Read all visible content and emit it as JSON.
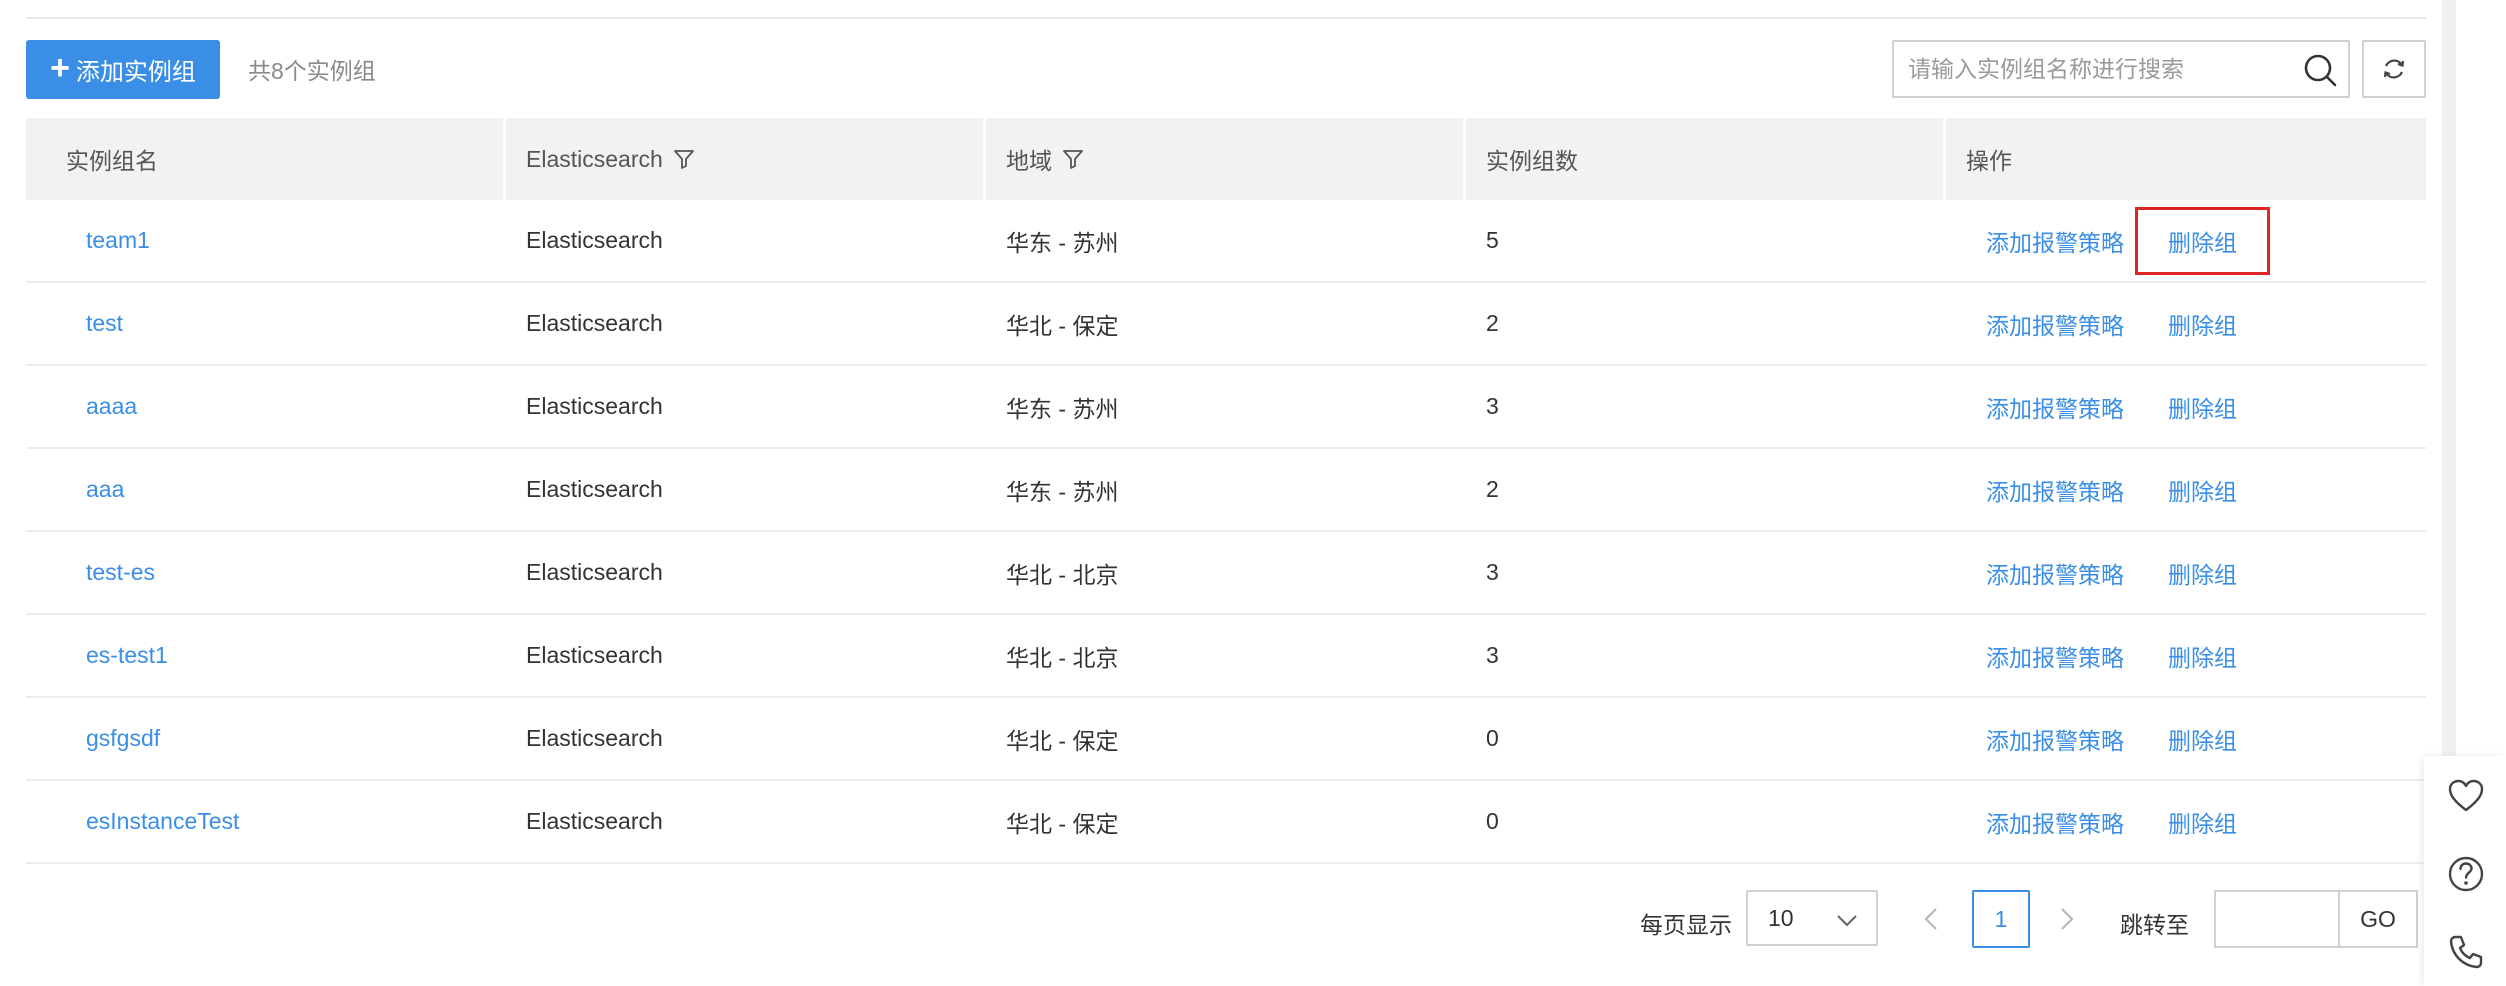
{
  "toolbar": {
    "add_label": "添加实例组",
    "total_text": "共8个实例组",
    "search_placeholder": "请输入实例组名称进行搜索"
  },
  "table": {
    "columns": [
      "实例组名",
      "Elasticsearch",
      "地域",
      "实例组数",
      "操作"
    ],
    "filterable": [
      false,
      true,
      true,
      false,
      false
    ],
    "action_labels": {
      "add_policy": "添加报警策略",
      "delete_group": "删除组"
    },
    "rows": [
      {
        "name": "team1",
        "product": "Elasticsearch",
        "region": "华东 - 苏州",
        "count": "5"
      },
      {
        "name": "test",
        "product": "Elasticsearch",
        "region": "华北 - 保定",
        "count": "2"
      },
      {
        "name": "aaaa",
        "product": "Elasticsearch",
        "region": "华东 - 苏州",
        "count": "3"
      },
      {
        "name": "aaa",
        "product": "Elasticsearch",
        "region": "华东 - 苏州",
        "count": "2"
      },
      {
        "name": "test-es",
        "product": "Elasticsearch",
        "region": "华北 - 北京",
        "count": "3"
      },
      {
        "name": "es-test1",
        "product": "Elasticsearch",
        "region": "华北 - 北京",
        "count": "3"
      },
      {
        "name": "gsfgsdf",
        "product": "Elasticsearch",
        "region": "华北 - 保定",
        "count": "0"
      },
      {
        "name": "esInstanceTest",
        "product": "Elasticsearch",
        "region": "华北 - 保定",
        "count": "0"
      }
    ]
  },
  "pagination": {
    "per_page_label": "每页显示",
    "per_page_value": "10",
    "current_page": "1",
    "jump_label": "跳转至",
    "go_label": "GO"
  },
  "floating_icons": [
    "heart-icon",
    "help-circle-icon",
    "phone-icon"
  ],
  "colors": {
    "primary": "#3a8ee6",
    "highlight_border": "#e02525",
    "header_bg": "#f2f2f2"
  }
}
